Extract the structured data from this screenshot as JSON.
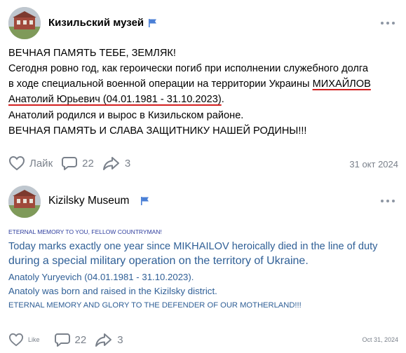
{
  "post1": {
    "author": "Кизильский музей",
    "lines": {
      "l1": "ВЕЧНАЯ ПАМЯТЬ ТЕБЕ, ЗЕМЛЯК!",
      "l2": "Сегодня ровно год, как героически погиб при исполнении служебного долга",
      "l3a": "в ходе специальной военной операции на территории Украины ",
      "l3b": "МИХАЙЛОВ",
      "l4a": "Анатолий Юрьевич (04.01.1981 - 31.10.2023)",
      "l4b": ".",
      "l5": "Анатолий родился и вырос в Кизильском районе.",
      "l6": "ВЕЧНАЯ ПАМЯТЬ И СЛАВА ЗАЩИТНИКУ НАШЕЙ РОДИНЫ!!!"
    },
    "like_label": "Лайк",
    "comments": "22",
    "shares": "3",
    "date": "31 окт 2024"
  },
  "post2": {
    "author": "Kizilsky Museum",
    "lines": {
      "l1": "ETERNAL MEMORY TO YOU, FELLOW COUNTRYMAN!",
      "l2": "Today marks exactly one year since MIKHAILOV heroically died in the line of duty",
      "l3": "during a special military operation on the territory of Ukraine.",
      "l4": "Anatoly Yuryevich (04.01.1981 - 31.10.2023).",
      "l5": "Anatoly was born and raised in the Kizilsky district.",
      "l6": "ETERNAL MEMORY AND GLORY TO THE DEFENDER OF OUR MOTHERLAND!!!"
    },
    "like_label": "Like",
    "comments": "22",
    "shares": "3",
    "date": "Oct 31, 2024"
  },
  "colors": {
    "accent_flag": "#4a7fd6",
    "underline_red": "#d21e1e",
    "meta_gray": "#7a818b"
  },
  "icons": [
    "flag-icon",
    "more-icon",
    "heart-icon",
    "comment-icon",
    "share-icon"
  ]
}
